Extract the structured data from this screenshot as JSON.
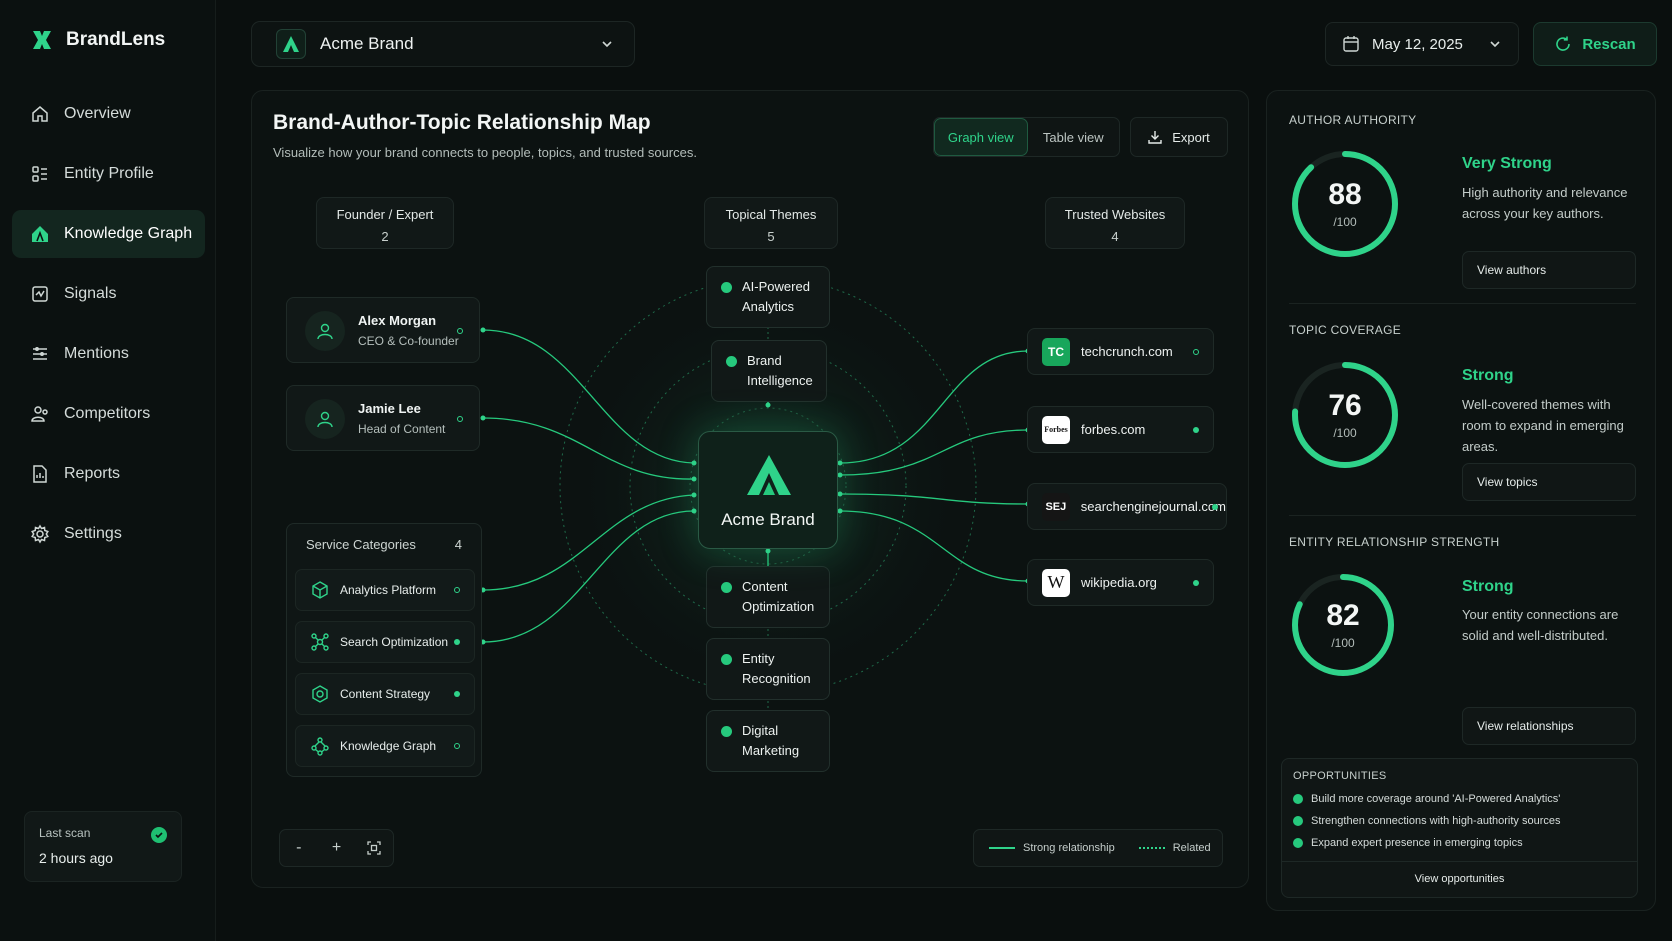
{
  "app": {
    "name": "BrandLens"
  },
  "sidebar": {
    "items": [
      {
        "label": "Overview",
        "icon": "home-icon"
      },
      {
        "label": "Entity Profile",
        "icon": "entity-icon"
      },
      {
        "label": "Knowledge Graph",
        "icon": "graph-icon",
        "active": true
      },
      {
        "label": "Signals",
        "icon": "signal-icon"
      },
      {
        "label": "Mentions",
        "icon": "list-icon"
      },
      {
        "label": "Competitors",
        "icon": "users-icon"
      },
      {
        "label": "Reports",
        "icon": "report-icon"
      },
      {
        "label": "Settings",
        "icon": "gear-icon"
      }
    ],
    "last_scan": {
      "label": "Last scan",
      "value": "2 hours ago"
    }
  },
  "header": {
    "brand": "Acme Brand",
    "date": "May 12, 2025",
    "rescan": "Rescan"
  },
  "main": {
    "title": "Brand-Author-Topic Relationship Map",
    "subtitle": "Visualize how your brand connects to people, topics, and trusted sources.",
    "views": [
      "Graph view",
      "Table view"
    ],
    "active_view": "Graph view",
    "export": "Export",
    "columns": [
      {
        "title": "Founder / Expert",
        "count": "2"
      },
      {
        "title": "Topical Themes",
        "count": "5"
      },
      {
        "title": "Trusted Websites",
        "count": "4"
      }
    ],
    "people": [
      {
        "name": "Alex Morgan",
        "role": "CEO & Co-founder"
      },
      {
        "name": "Jamie Lee",
        "role": "Head of Content"
      }
    ],
    "services": {
      "title": "Service Categories",
      "count": "4",
      "items": [
        "Analytics Platform",
        "Search Optimization",
        "Content Strategy",
        "Knowledge Graph"
      ]
    },
    "topics": [
      {
        "l1": "AI-Powered",
        "l2": "Analytics"
      },
      {
        "l1": "Brand",
        "l2": "Intelligence"
      },
      {
        "l1": "Content",
        "l2": "Optimization"
      },
      {
        "l1": "Entity",
        "l2": "Recognition"
      },
      {
        "l1": "Digital",
        "l2": "Marketing"
      }
    ],
    "center": "Acme Brand",
    "sites": [
      {
        "name": "techcrunch.com",
        "logo": "TC"
      },
      {
        "name": "forbes.com",
        "logo": "Forbes"
      },
      {
        "name": "searchenginejournal.com",
        "logo": "SEJ"
      },
      {
        "name": "wikipedia.org",
        "logo": "W"
      }
    ],
    "legend": {
      "strong": "Strong relationship",
      "related": "Related"
    },
    "zoom": {
      "out": "-",
      "in": "+",
      "fit": "fit"
    }
  },
  "right": {
    "author": {
      "title": "AUTHOR AUTHORITY",
      "score": "88",
      "max": "/100",
      "score_value": 88,
      "rating": "Very Strong",
      "desc": "High authority and relevance across your key authors.",
      "button": "View authors"
    },
    "topic": {
      "title": "TOPIC COVERAGE",
      "score": "76",
      "max": "/100",
      "score_value": 76,
      "rating": "Strong",
      "desc": "Well-covered themes with room to expand in emerging areas.",
      "button": "View topics"
    },
    "entity": {
      "title": "ENTITY RELATIONSHIP STRENGTH",
      "score": "82",
      "max": "/100",
      "score_value": 82,
      "rating": "Strong",
      "desc": "Your entity connections are solid and well-distributed.",
      "button": "View relationships"
    },
    "opportunities": {
      "title": "OPPORTUNITIES",
      "items": [
        "Build more coverage around 'AI-Powered Analytics'",
        "Strengthen connections with high-authority sources",
        "Expand expert presence in emerging topics"
      ],
      "button": "View opportunities"
    }
  },
  "colors": {
    "accent": "#2fd38a",
    "bg": "#0a0f0e",
    "panel": "#0c1211"
  }
}
